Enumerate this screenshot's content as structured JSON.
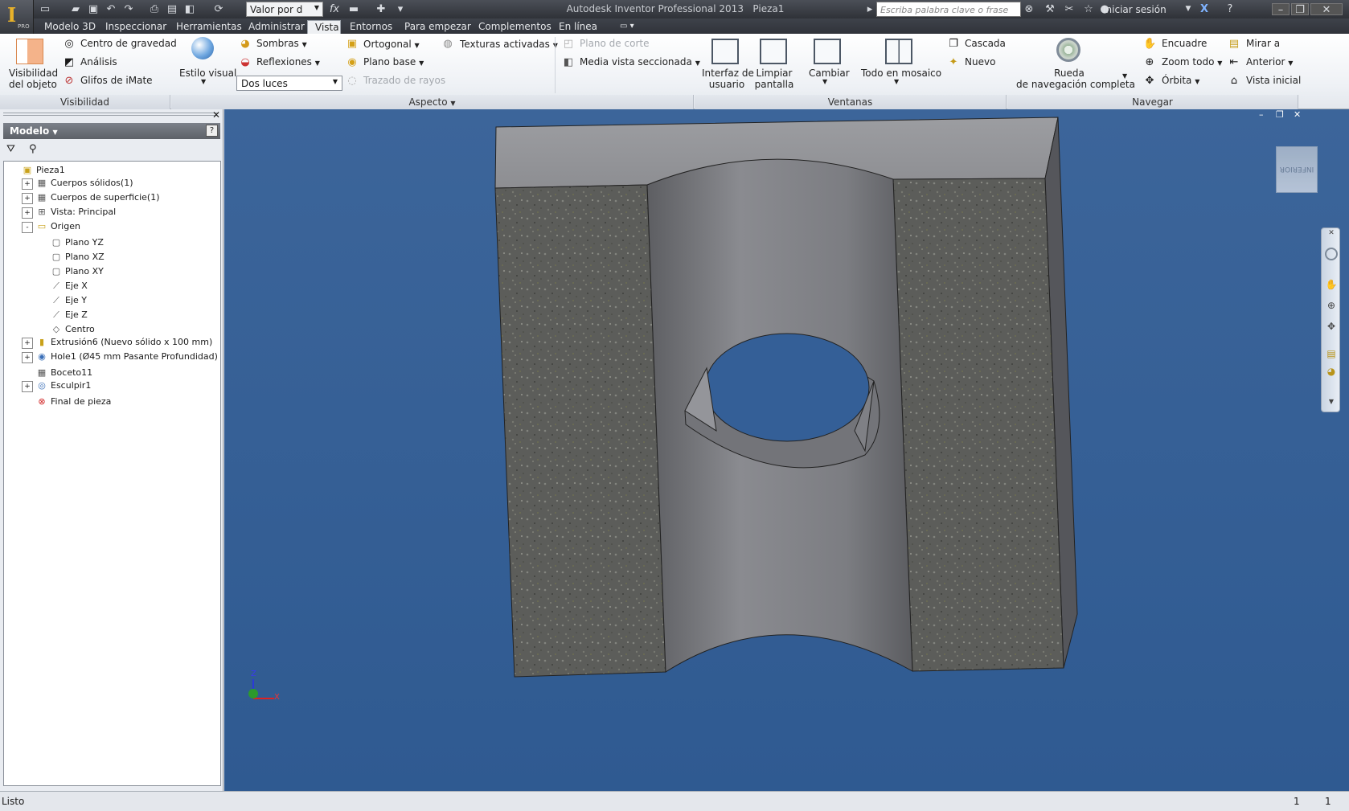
{
  "app": {
    "title": "Autodesk Inventor Professional 2013",
    "document": "Pieza1",
    "logo_text": "I",
    "edition": "PRO"
  },
  "quick": {
    "value_select": "Valor por d",
    "fx": "fx"
  },
  "search": {
    "placeholder": "Escriba palabra clave o frase"
  },
  "account": {
    "login": "Iniciar sesión"
  },
  "tabs": [
    "Modelo 3D",
    "Inspeccionar",
    "Herramientas",
    "Administrar",
    "Vista",
    "Entornos",
    "Para empezar",
    "Complementos",
    "En línea"
  ],
  "active_tab": "Vista",
  "ribbon": {
    "visibilidad": {
      "title": "Visibilidad",
      "obj1": "Visibilidad",
      "obj2": "del objeto",
      "centro": "Centro de gravedad",
      "analisis": "Análisis",
      "glifos": "Glifos de iMate"
    },
    "aspecto": {
      "title": "Aspecto",
      "estilo": "Estilo visual",
      "sombras": "Sombras",
      "reflexiones": "Reflexiones",
      "luces": "Dos luces",
      "ortogonal": "Ortogonal",
      "plano_base": "Plano base",
      "trazado": "Trazado de rayos",
      "texturas": "Texturas activadas",
      "plano_corte": "Plano de corte",
      "media_vista": "Media vista seccionada"
    },
    "ventanas": {
      "title": "Ventanas",
      "interfaz1": "Interfaz de",
      "interfaz2": "usuario",
      "limpiar1": "Limpiar",
      "limpiar2": "pantalla",
      "cambiar": "Cambiar",
      "mosaico": "Todo en mosaico",
      "cascada": "Cascada",
      "nuevo": "Nuevo"
    },
    "navegar": {
      "title": "Navegar",
      "rueda1": "Rueda",
      "rueda2": "de navegación completa",
      "encuadre": "Encuadre",
      "zoom": "Zoom todo",
      "orbita": "Órbita",
      "mirar": "Mirar a",
      "anterior": "Anterior",
      "inicial": "Vista inicial"
    }
  },
  "browser": {
    "title": "Modelo",
    "tree": [
      {
        "label": "Pieza1",
        "exp": "",
        "lvl": 0,
        "icon": "part-icon"
      },
      {
        "label": "Cuerpos sólidos(1)",
        "exp": "+",
        "lvl": 1,
        "icon": "solid-bodies-icon"
      },
      {
        "label": "Cuerpos de superficie(1)",
        "exp": "+",
        "lvl": 1,
        "icon": "surface-bodies-icon"
      },
      {
        "label": "Vista: Principal",
        "exp": "+",
        "lvl": 1,
        "icon": "view-icon"
      },
      {
        "label": "Origen",
        "exp": "-",
        "lvl": 1,
        "icon": "folder-icon"
      },
      {
        "label": "Plano YZ",
        "exp": "",
        "lvl": 2,
        "icon": "plane-icon"
      },
      {
        "label": "Plano XZ",
        "exp": "",
        "lvl": 2,
        "icon": "plane-icon"
      },
      {
        "label": "Plano XY",
        "exp": "",
        "lvl": 2,
        "icon": "plane-icon"
      },
      {
        "label": "Eje X",
        "exp": "",
        "lvl": 2,
        "icon": "axis-icon"
      },
      {
        "label": "Eje Y",
        "exp": "",
        "lvl": 2,
        "icon": "axis-icon"
      },
      {
        "label": "Eje Z",
        "exp": "",
        "lvl": 2,
        "icon": "axis-icon"
      },
      {
        "label": "Centro",
        "exp": "",
        "lvl": 2,
        "icon": "point-icon"
      },
      {
        "label": "Extrusión6 (Nuevo sólido x 100 mm)",
        "exp": "+",
        "lvl": 1,
        "icon": "extrude-icon"
      },
      {
        "label": "Hole1 (Ø45 mm Pasante Profundidad)",
        "exp": "+",
        "lvl": 1,
        "icon": "hole-icon"
      },
      {
        "label": "Boceto11",
        "exp": "",
        "lvl": 1,
        "icon": "sketch-icon"
      },
      {
        "label": "Esculpir1",
        "exp": "+",
        "lvl": 1,
        "icon": "sculpt-icon"
      },
      {
        "label": "Final de pieza",
        "exp": "",
        "lvl": 1,
        "icon": "end-of-part-icon"
      }
    ]
  },
  "viewcube": {
    "label": "INFERIOR"
  },
  "triad": {
    "z": "Z",
    "x": "X"
  },
  "status": {
    "text": "Listo",
    "n1": "1",
    "n2": "1"
  },
  "colors": {
    "viewport": "#36629a",
    "ribbon": "#eef1f5",
    "titlebar": "#3a3d44"
  }
}
